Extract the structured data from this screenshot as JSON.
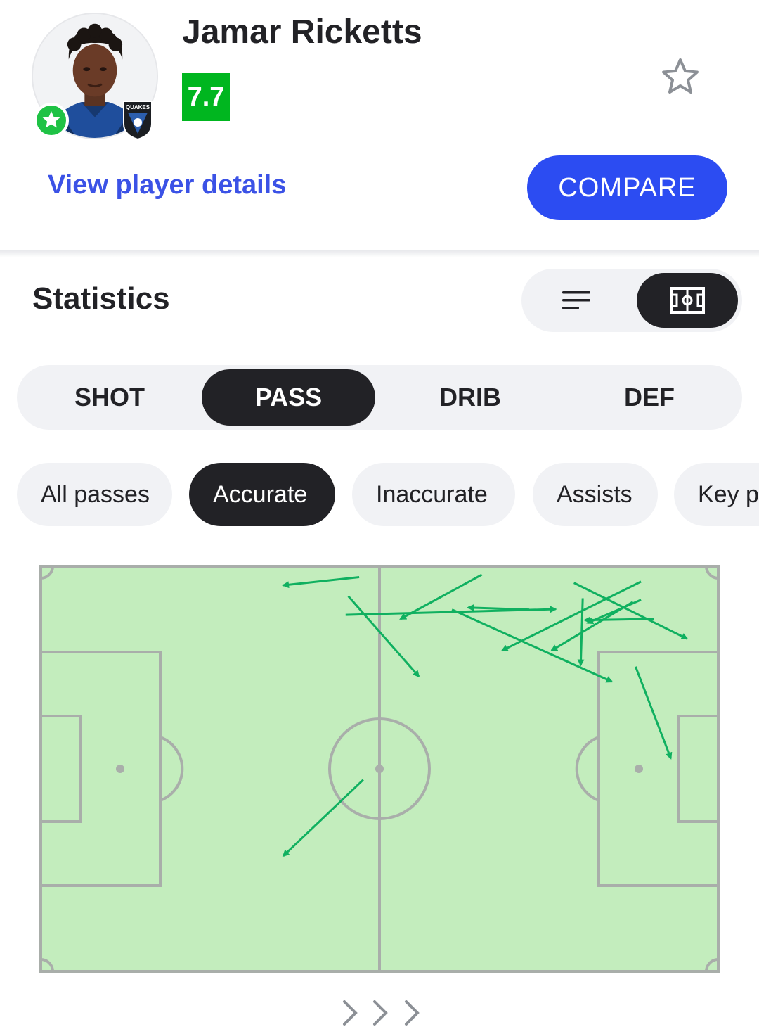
{
  "player": {
    "name": "Jamar Ricketts",
    "rating": "7.7",
    "rating_color": "#00b61f",
    "club_badge_text": "QUAKES",
    "view_details_label": "View player details",
    "compare_label": "COMPARE"
  },
  "statistics": {
    "title": "Statistics",
    "view_modes": [
      "list-icon",
      "pitch-icon"
    ],
    "selected_view": "pitch",
    "categories": [
      {
        "label": "SHOT",
        "active": false
      },
      {
        "label": "PASS",
        "active": true
      },
      {
        "label": "DRIB",
        "active": false
      },
      {
        "label": "DEF",
        "active": false
      }
    ],
    "filters": [
      {
        "label": "All passes",
        "active": false
      },
      {
        "label": "Accurate",
        "active": true
      },
      {
        "label": "Inaccurate",
        "active": false
      },
      {
        "label": "Assists",
        "active": false
      },
      {
        "label": "Key passes",
        "active": false
      }
    ]
  },
  "pitch_map": {
    "pitch_color": "#c3edbd",
    "line_color": "#a9aeaa",
    "arrow_color": "#10b060",
    "passes": [
      {
        "from": [
          47.0,
          2.7
        ],
        "to": [
          35.8,
          4.7
        ]
      },
      {
        "from": [
          45.4,
          7.4
        ],
        "to": [
          55.8,
          27.2
        ]
      },
      {
        "from": [
          45.0,
          12.0
        ],
        "to": [
          76.0,
          10.6
        ]
      },
      {
        "from": [
          65.1,
          2.1
        ],
        "to": [
          53.1,
          13.0
        ]
      },
      {
        "from": [
          60.7,
          10.7
        ],
        "to": [
          84.3,
          28.5
        ]
      },
      {
        "from": [
          72.1,
          10.7
        ],
        "to": [
          63.1,
          10.2
        ]
      },
      {
        "from": [
          88.6,
          3.8
        ],
        "to": [
          68.1,
          20.8
        ]
      },
      {
        "from": [
          80.0,
          7.9
        ],
        "to": [
          79.7,
          24.4
        ]
      },
      {
        "from": [
          87.4,
          8.8
        ],
        "to": [
          75.4,
          20.8
        ]
      },
      {
        "from": [
          90.5,
          13.0
        ],
        "to": [
          80.3,
          13.3
        ]
      },
      {
        "from": [
          88.6,
          8.3
        ],
        "to": [
          80.7,
          14.0
        ]
      },
      {
        "from": [
          78.7,
          4.1
        ],
        "to": [
          95.4,
          17.9
        ]
      },
      {
        "from": [
          87.8,
          24.8
        ],
        "to": [
          93.0,
          47.4
        ]
      },
      {
        "from": [
          47.6,
          52.7
        ],
        "to": [
          35.8,
          71.5
        ]
      }
    ]
  }
}
